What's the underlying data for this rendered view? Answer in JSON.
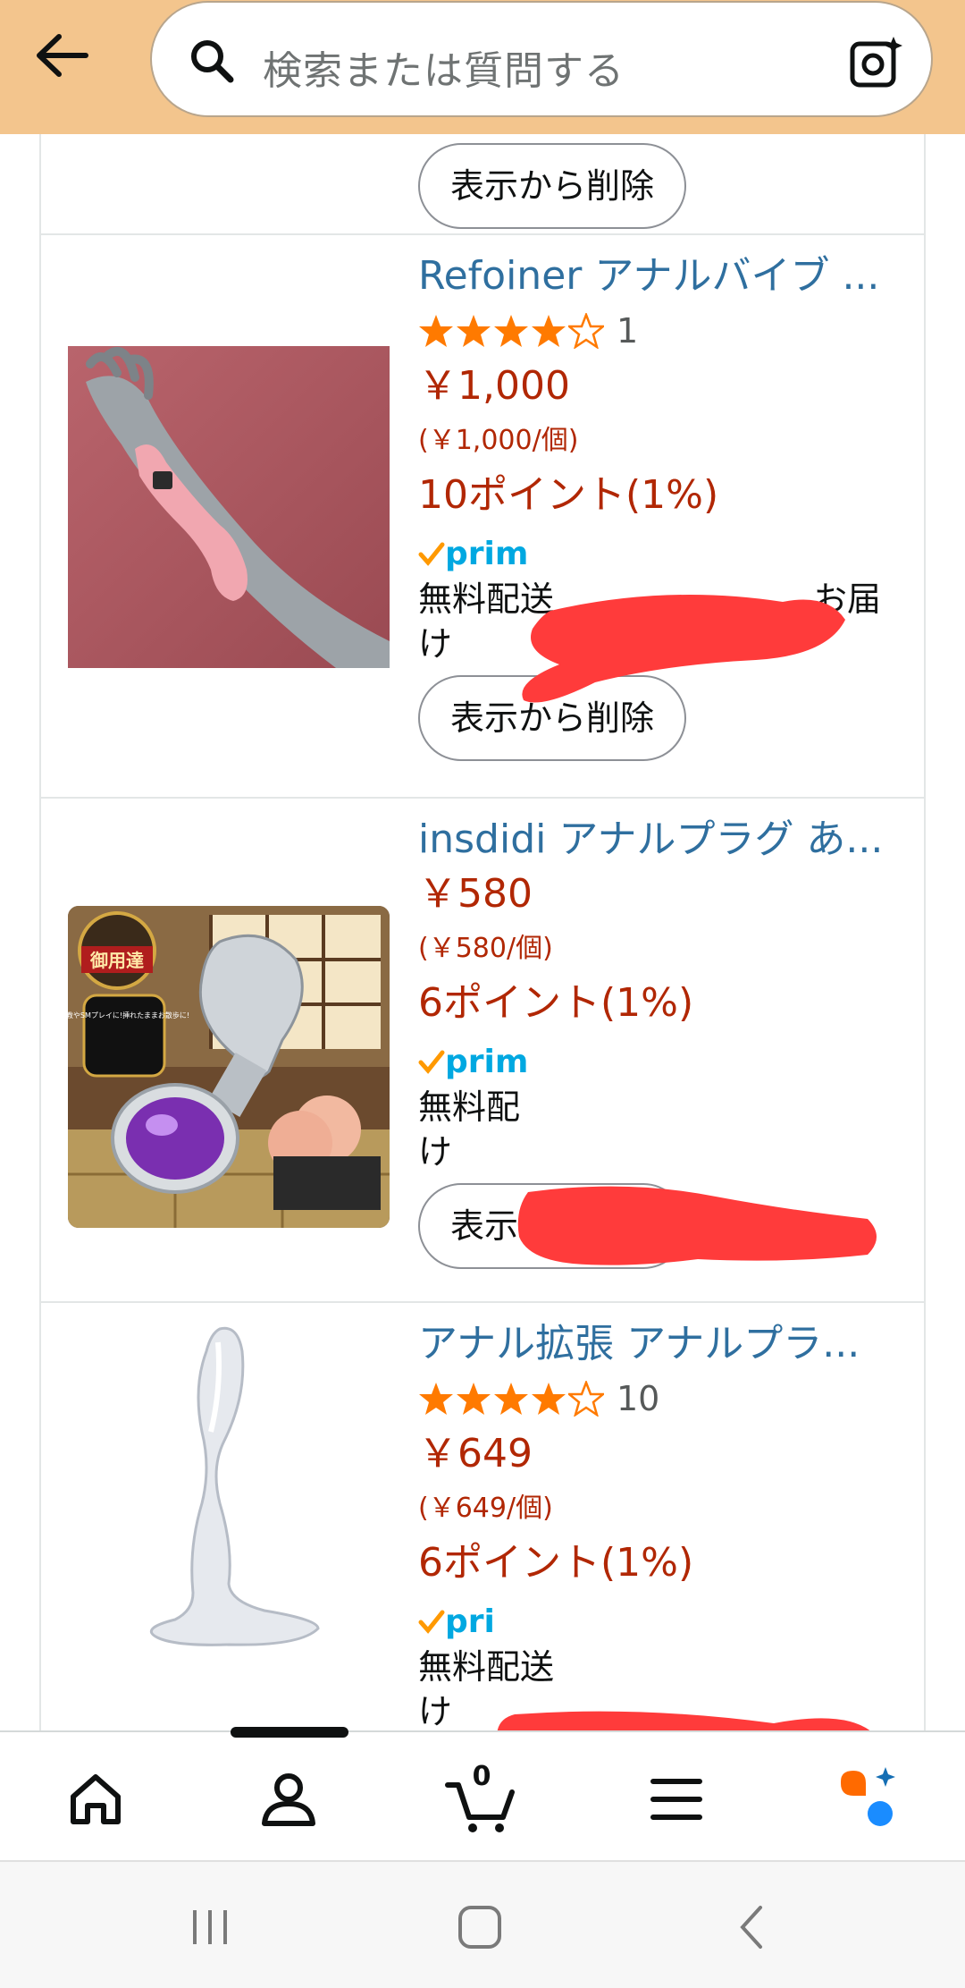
{
  "header": {
    "search_placeholder": "検索または質問する"
  },
  "colors": {
    "header_bg": "#f3c58d",
    "title_link": "#2f6f9f",
    "price": "#b12704",
    "star": "#ff7a00",
    "redaction": "#ff3b3b"
  },
  "icons": {
    "back": "back-arrow-icon",
    "search": "search-icon",
    "camera": "camera-lens-icon",
    "home": "home-icon",
    "account": "account-icon",
    "cart": "cart-icon",
    "menu": "menu-icon",
    "assistant": "assistant-icon"
  },
  "products": [
    {
      "remove_label": "表示から削除"
    },
    {
      "title": "Refoiner アナルバイブ ...",
      "rating": 4,
      "rating_count": "1",
      "price": "￥1,000",
      "unit_price": "(￥1,000/個)",
      "points": "10ポイント(1%)",
      "prime": "prim",
      "delivery_line1": "無料配送",
      "delivery_tail": "お届",
      "delivery_line2": "け",
      "remove_label": "表示から削除"
    },
    {
      "title": "insdidi アナルプラグ あ...",
      "price": "￥580",
      "unit_price": "(￥580/個)",
      "points": "6ポイント(1%)",
      "prime": "prim",
      "delivery_line1": "無料配",
      "delivery_line2": "け",
      "remove_label": "表示から削除",
      "image_badge": "御用達",
      "image_caption": "調教やSMプレイに!挿れたままお散歩に!"
    },
    {
      "title": "アナル拡張 アナルプラ...",
      "rating": 4,
      "rating_count": "10",
      "price": "￥649",
      "unit_price": "(￥649/個)",
      "points": "6ポイント(1%)",
      "prime": "pri",
      "delivery_line1": "無料配送",
      "delivery_line2": "け"
    }
  ],
  "bottom_nav": {
    "cart_count": "0",
    "active_tab": "account"
  }
}
